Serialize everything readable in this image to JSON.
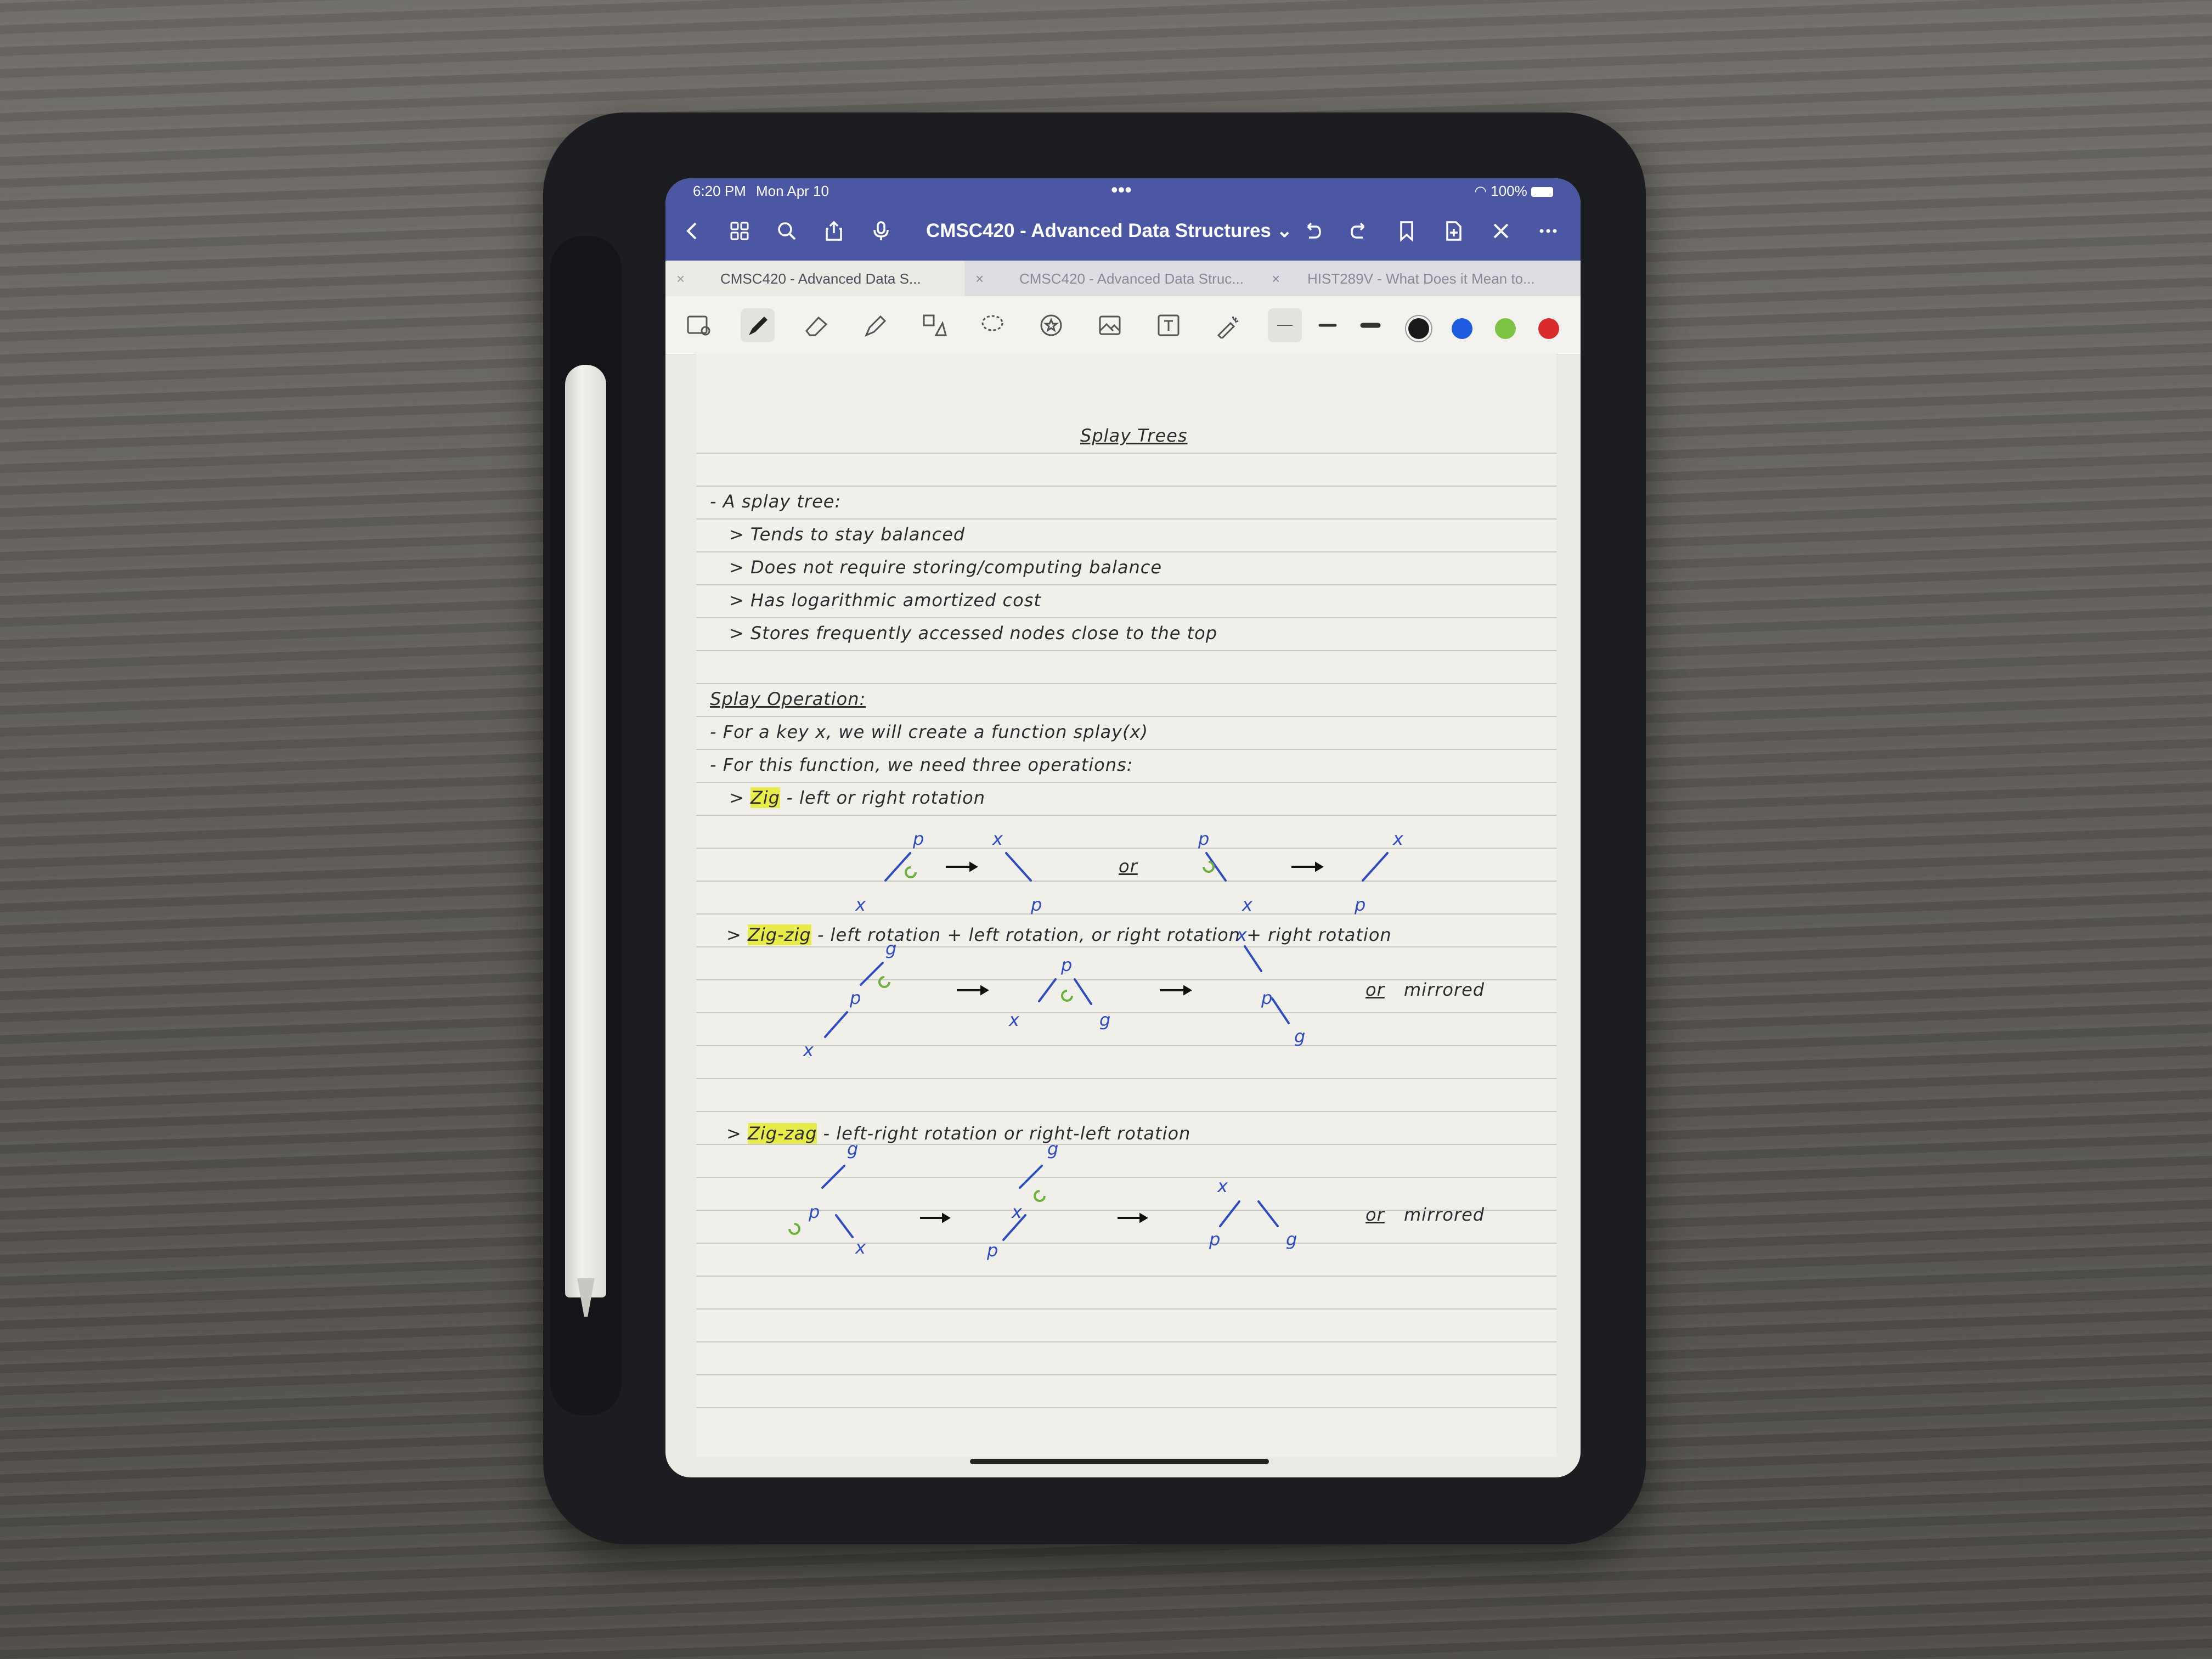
{
  "status": {
    "time": "6:20 PM",
    "date": "Mon Apr 10",
    "dots": "•••",
    "battery": "100%"
  },
  "toolbar": {
    "title": "CMSC420 - Advanced Data Structures ⌄"
  },
  "tabs": [
    {
      "label": "CMSC420 - Advanced Data S..."
    },
    {
      "label": "CMSC420 - Advanced Data Struc..."
    },
    {
      "label": "HIST289V - What Does it Mean to..."
    }
  ],
  "colors": {
    "accent": "#4b57a3",
    "swatches": [
      "#1a1a1a",
      "#1f5bde",
      "#7cc243",
      "#d92b2b"
    ]
  },
  "note": {
    "title": "Splay Trees",
    "intro": "- A splay tree:",
    "bullets": [
      "> Tends to stay balanced",
      "> Does not require storing/computing balance",
      "> Has logarithmic amortized cost",
      "> Stores frequently accessed nodes close to the top"
    ],
    "section": "Splay Operation:",
    "lines": [
      "- For a key x, we will create a function splay(x)",
      "- For this function, we need three operations:"
    ],
    "zig": {
      "marker": ">",
      "name": "Zig",
      "desc": "- left or right rotation"
    },
    "zigzig": {
      "marker": ">",
      "name": "Zig-zig",
      "desc": "- left rotation + left rotation, or right rotation + right rotation"
    },
    "zigzag": {
      "marker": ">",
      "name": "Zig-zag",
      "desc": "- left-right rotation or right-left rotation"
    },
    "or": "or",
    "mirrored": "mirrored",
    "nodes": {
      "p": "p",
      "x": "x",
      "g": "g"
    }
  }
}
